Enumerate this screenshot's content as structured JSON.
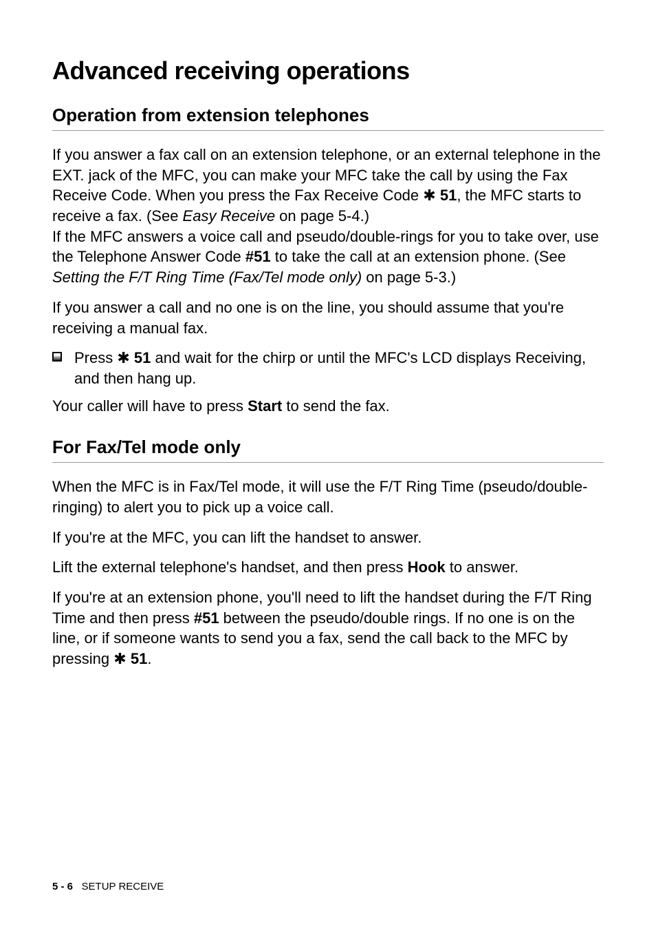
{
  "main_heading": "Advanced receiving operations",
  "section1": {
    "heading": "Operation from extension telephones",
    "para1_a": "If you answer a fax call on an extension telephone, or an external telephone in the EXT. jack of the MFC, you can make your MFC take the call by using the Fax Receive Code. When you press the Fax Receive Code ",
    "code1": "51",
    "para1_b": ", the MFC starts to receive a fax. (See ",
    "ref1": "Easy Receive",
    "para1_c": " on page 5-4.)",
    "para2_a": "If the MFC answers a voice call and pseudo/double-rings for you to take over, use the Telephone Answer Code ",
    "code2": "#51",
    "para2_b": " to take the call at an extension phone. (See ",
    "ref2": "Setting the F/T Ring Time (Fax/Tel mode only)",
    "para2_c": " on page 5-3.)",
    "para3": "If you answer a call and no one is on the line, you should assume that you're receiving a manual fax.",
    "bullet_a": "Press ",
    "bullet_code": "51",
    "bullet_b": " and wait for the chirp or until the MFC's LCD displays Receiving, and then hang up.",
    "para4_a": "Your caller will have to press ",
    "para4_bold": "Start",
    "para4_b": " to send the fax."
  },
  "section2": {
    "heading": "For Fax/Tel mode only",
    "para1": "When the MFC is in Fax/Tel mode, it will use the F/T Ring Time (pseudo/double-ringing) to alert you to pick up a voice call.",
    "para2": "If you're at the MFC, you can lift the handset to answer.",
    "para3_a": "Lift the external telephone's handset, and then press ",
    "para3_bold": "Hook",
    "para3_b": " to answer.",
    "para4_a": "If you're at an extension phone, you'll need to lift the handset during the F/T Ring Time and then press ",
    "para4_code1": "#51",
    "para4_b": " between the pseudo/double rings. If no one is on the line, or if someone wants to send you a fax, send the call back to the MFC by pressing ",
    "para4_code2": "51",
    "para4_c": "."
  },
  "footer": {
    "page": "5 - 6",
    "label": "SETUP RECEIVE"
  },
  "star": "✱"
}
